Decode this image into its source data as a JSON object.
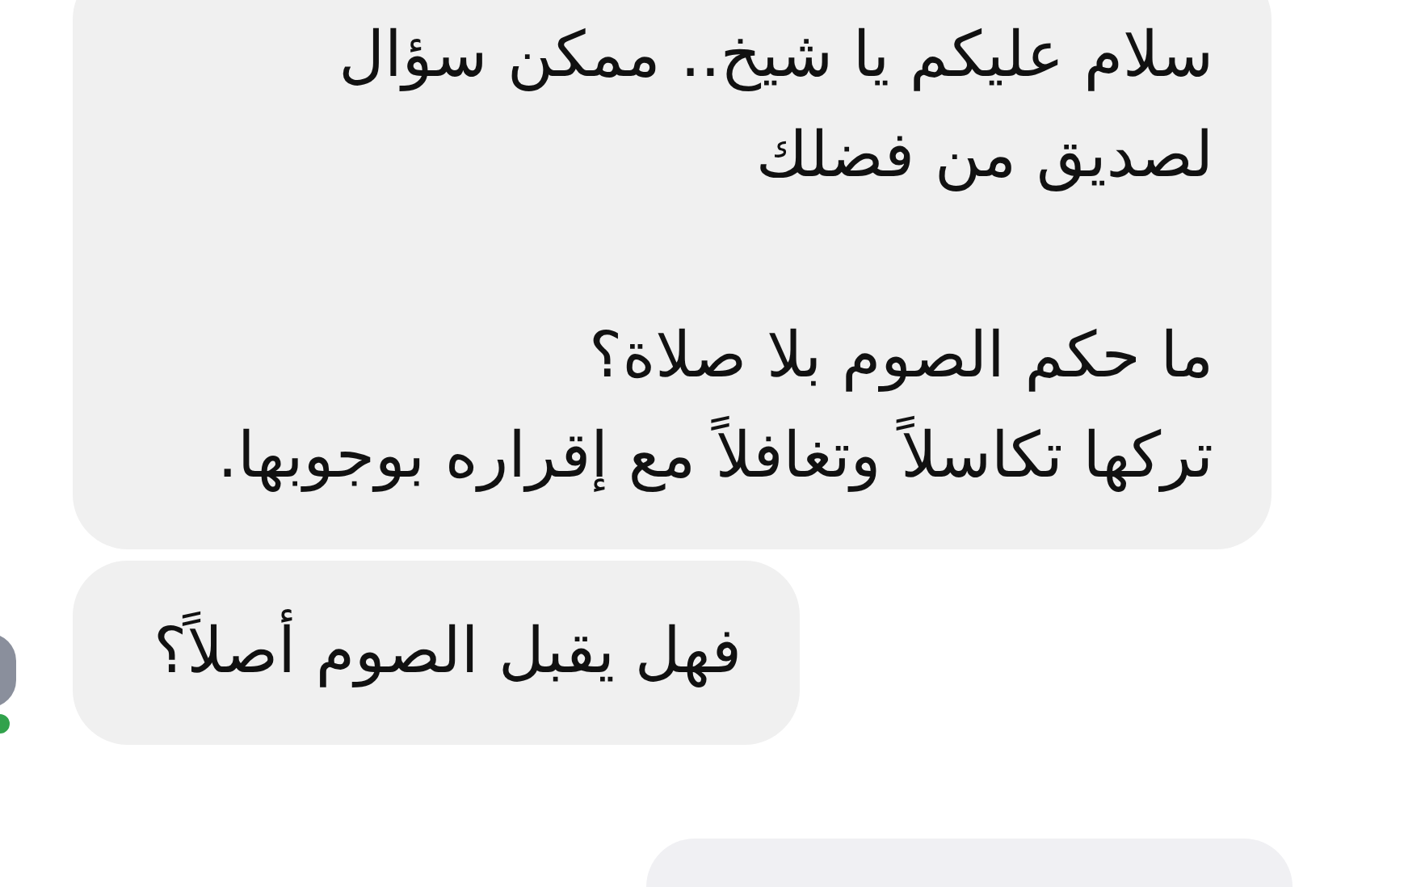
{
  "messages": [
    {
      "kind": "received",
      "paragraphs": [
        [
          "سلام عليكم يا شيخ.. ممكن سؤال",
          "لصديق من فضلك"
        ],
        [
          "ما حكم الصوم بلا صلاة؟",
          "تركها تكاسلاً وتغافلاً مع إقراره بوجوبها."
        ]
      ],
      "avatar": false
    },
    {
      "kind": "received",
      "paragraphs": [
        [
          "فهل يقبل الصوم أصلاً؟"
        ]
      ],
      "avatar": true,
      "online": true
    },
    {
      "kind": "sent"
    }
  ]
}
